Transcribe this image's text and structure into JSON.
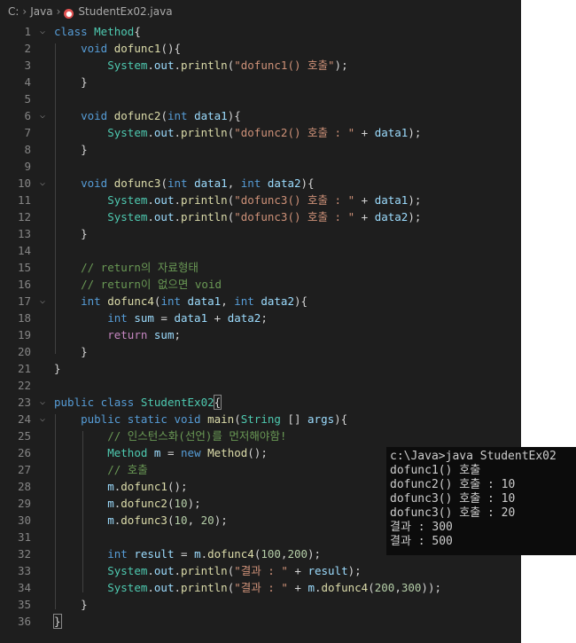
{
  "breadcrumb": {
    "root": "C:",
    "folder": "Java",
    "file": "StudentEx02.java"
  },
  "lines": [
    {
      "n": "1",
      "fold": "⌵",
      "t": [
        [
          "kw",
          "class "
        ],
        [
          "ty",
          "Method"
        ],
        [
          "p",
          "{"
        ]
      ]
    },
    {
      "n": "2",
      "t": [
        [
          "p",
          "    "
        ],
        [
          "kw",
          "void "
        ],
        [
          "fn",
          "dofunc1"
        ],
        [
          "p",
          "(){"
        ]
      ]
    },
    {
      "n": "3",
      "t": [
        [
          "p",
          "        "
        ],
        [
          "ty",
          "System"
        ],
        [
          "p",
          "."
        ],
        [
          "var",
          "out"
        ],
        [
          "p",
          "."
        ],
        [
          "fn",
          "println"
        ],
        [
          "p",
          "("
        ],
        [
          "str",
          "\"dofunc1() 호출\""
        ],
        [
          "p",
          ");"
        ]
      ]
    },
    {
      "n": "4",
      "t": [
        [
          "p",
          "    }"
        ]
      ]
    },
    {
      "n": "5",
      "t": []
    },
    {
      "n": "6",
      "fold": "⌵",
      "t": [
        [
          "p",
          "    "
        ],
        [
          "kw",
          "void "
        ],
        [
          "fn",
          "dofunc2"
        ],
        [
          "p",
          "("
        ],
        [
          "kw",
          "int "
        ],
        [
          "var",
          "data1"
        ],
        [
          "p",
          "){"
        ]
      ]
    },
    {
      "n": "7",
      "t": [
        [
          "p",
          "        "
        ],
        [
          "ty",
          "System"
        ],
        [
          "p",
          "."
        ],
        [
          "var",
          "out"
        ],
        [
          "p",
          "."
        ],
        [
          "fn",
          "println"
        ],
        [
          "p",
          "("
        ],
        [
          "str",
          "\"dofunc2() 호출 : \""
        ],
        [
          "p",
          " + "
        ],
        [
          "var",
          "data1"
        ],
        [
          "p",
          ");"
        ]
      ]
    },
    {
      "n": "8",
      "t": [
        [
          "p",
          "    }"
        ]
      ]
    },
    {
      "n": "9",
      "t": []
    },
    {
      "n": "10",
      "fold": "⌵",
      "t": [
        [
          "p",
          "    "
        ],
        [
          "kw",
          "void "
        ],
        [
          "fn",
          "dofunc3"
        ],
        [
          "p",
          "("
        ],
        [
          "kw",
          "int "
        ],
        [
          "var",
          "data1"
        ],
        [
          "p",
          ", "
        ],
        [
          "kw",
          "int "
        ],
        [
          "var",
          "data2"
        ],
        [
          "p",
          "){"
        ]
      ]
    },
    {
      "n": "11",
      "t": [
        [
          "p",
          "        "
        ],
        [
          "ty",
          "System"
        ],
        [
          "p",
          "."
        ],
        [
          "var",
          "out"
        ],
        [
          "p",
          "."
        ],
        [
          "fn",
          "println"
        ],
        [
          "p",
          "("
        ],
        [
          "str",
          "\"dofunc3() 호출 : \""
        ],
        [
          "p",
          " + "
        ],
        [
          "var",
          "data1"
        ],
        [
          "p",
          ");"
        ]
      ]
    },
    {
      "n": "12",
      "t": [
        [
          "p",
          "        "
        ],
        [
          "ty",
          "System"
        ],
        [
          "p",
          "."
        ],
        [
          "var",
          "out"
        ],
        [
          "p",
          "."
        ],
        [
          "fn",
          "println"
        ],
        [
          "p",
          "("
        ],
        [
          "str",
          "\"dofunc3() 호출 : \""
        ],
        [
          "p",
          " + "
        ],
        [
          "var",
          "data2"
        ],
        [
          "p",
          ");"
        ]
      ]
    },
    {
      "n": "13",
      "t": [
        [
          "p",
          "    }"
        ]
      ]
    },
    {
      "n": "14",
      "t": []
    },
    {
      "n": "15",
      "t": [
        [
          "p",
          "    "
        ],
        [
          "cm",
          "// return의 자료형태"
        ]
      ]
    },
    {
      "n": "16",
      "t": [
        [
          "p",
          "    "
        ],
        [
          "cm",
          "// return이 없으면 void"
        ]
      ]
    },
    {
      "n": "17",
      "fold": "⌵",
      "t": [
        [
          "p",
          "    "
        ],
        [
          "kw",
          "int "
        ],
        [
          "fn",
          "dofunc4"
        ],
        [
          "p",
          "("
        ],
        [
          "kw",
          "int "
        ],
        [
          "var",
          "data1"
        ],
        [
          "p",
          ", "
        ],
        [
          "kw",
          "int "
        ],
        [
          "var",
          "data2"
        ],
        [
          "p",
          "){"
        ]
      ]
    },
    {
      "n": "18",
      "t": [
        [
          "p",
          "        "
        ],
        [
          "kw",
          "int "
        ],
        [
          "var",
          "sum"
        ],
        [
          "p",
          " = "
        ],
        [
          "var",
          "data1"
        ],
        [
          "p",
          " + "
        ],
        [
          "var",
          "data2"
        ],
        [
          "p",
          ";"
        ]
      ]
    },
    {
      "n": "19",
      "t": [
        [
          "p",
          "        "
        ],
        [
          "ctl",
          "return "
        ],
        [
          "var",
          "sum"
        ],
        [
          "p",
          ";"
        ]
      ]
    },
    {
      "n": "20",
      "t": [
        [
          "p",
          "    }"
        ]
      ]
    },
    {
      "n": "21",
      "t": [
        [
          "p",
          "}"
        ]
      ]
    },
    {
      "n": "22",
      "t": []
    },
    {
      "n": "23",
      "fold": "⌵",
      "t": [
        [
          "kw",
          "public class "
        ],
        [
          "ty",
          "StudentEx02"
        ],
        [
          "b",
          "{"
        ]
      ]
    },
    {
      "n": "24",
      "fold": "⌵",
      "t": [
        [
          "p",
          "    "
        ],
        [
          "kw",
          "public static void "
        ],
        [
          "fn",
          "main"
        ],
        [
          "p",
          "("
        ],
        [
          "ty",
          "String"
        ],
        [
          "p",
          " [] "
        ],
        [
          "var",
          "args"
        ],
        [
          "p",
          "){"
        ]
      ]
    },
    {
      "n": "25",
      "t": [
        [
          "p",
          "        "
        ],
        [
          "cm",
          "// 인스턴스화(선언)를 먼저해야함!"
        ]
      ]
    },
    {
      "n": "26",
      "t": [
        [
          "p",
          "        "
        ],
        [
          "ty",
          "Method "
        ],
        [
          "var",
          "m"
        ],
        [
          "p",
          " = "
        ],
        [
          "kw",
          "new "
        ],
        [
          "fn",
          "Method"
        ],
        [
          "p",
          "();"
        ]
      ]
    },
    {
      "n": "27",
      "t": [
        [
          "p",
          "        "
        ],
        [
          "cm",
          "// 호출"
        ]
      ]
    },
    {
      "n": "28",
      "t": [
        [
          "p",
          "        "
        ],
        [
          "var",
          "m"
        ],
        [
          "p",
          "."
        ],
        [
          "fn",
          "dofunc1"
        ],
        [
          "p",
          "();"
        ]
      ]
    },
    {
      "n": "29",
      "t": [
        [
          "p",
          "        "
        ],
        [
          "var",
          "m"
        ],
        [
          "p",
          "."
        ],
        [
          "fn",
          "dofunc2"
        ],
        [
          "p",
          "("
        ],
        [
          "num",
          "10"
        ],
        [
          "p",
          ");"
        ]
      ]
    },
    {
      "n": "30",
      "t": [
        [
          "p",
          "        "
        ],
        [
          "var",
          "m"
        ],
        [
          "p",
          "."
        ],
        [
          "fn",
          "dofunc3"
        ],
        [
          "p",
          "("
        ],
        [
          "num",
          "10"
        ],
        [
          "p",
          ", "
        ],
        [
          "num",
          "20"
        ],
        [
          "p",
          ");"
        ]
      ]
    },
    {
      "n": "31",
      "t": []
    },
    {
      "n": "32",
      "t": [
        [
          "p",
          "        "
        ],
        [
          "kw",
          "int "
        ],
        [
          "var",
          "result"
        ],
        [
          "p",
          " = "
        ],
        [
          "var",
          "m"
        ],
        [
          "p",
          "."
        ],
        [
          "fn",
          "dofunc4"
        ],
        [
          "p",
          "("
        ],
        [
          "num",
          "100"
        ],
        [
          "p",
          ","
        ],
        [
          "num",
          "200"
        ],
        [
          "p",
          ");"
        ]
      ]
    },
    {
      "n": "33",
      "t": [
        [
          "p",
          "        "
        ],
        [
          "ty",
          "System"
        ],
        [
          "p",
          "."
        ],
        [
          "var",
          "out"
        ],
        [
          "p",
          "."
        ],
        [
          "fn",
          "println"
        ],
        [
          "p",
          "("
        ],
        [
          "str",
          "\"결과 : \""
        ],
        [
          "p",
          " + "
        ],
        [
          "var",
          "result"
        ],
        [
          "p",
          ");"
        ]
      ]
    },
    {
      "n": "34",
      "t": [
        [
          "p",
          "        "
        ],
        [
          "ty",
          "System"
        ],
        [
          "p",
          "."
        ],
        [
          "var",
          "out"
        ],
        [
          "p",
          "."
        ],
        [
          "fn",
          "println"
        ],
        [
          "p",
          "("
        ],
        [
          "str",
          "\"결과 : \""
        ],
        [
          "p",
          " + "
        ],
        [
          "var",
          "m"
        ],
        [
          "p",
          "."
        ],
        [
          "fn",
          "dofunc4"
        ],
        [
          "p",
          "("
        ],
        [
          "num",
          "200"
        ],
        [
          "p",
          ","
        ],
        [
          "num",
          "300"
        ],
        [
          "p",
          "));"
        ]
      ]
    },
    {
      "n": "35",
      "t": [
        [
          "p",
          "    }"
        ]
      ]
    },
    {
      "n": "36",
      "t": [
        [
          "b",
          "}"
        ]
      ]
    }
  ],
  "terminal": {
    "lines": [
      "c:\\Java>java StudentEx02",
      "dofunc1() 호출",
      "dofunc2() 호출 : 10",
      "dofunc3() 호출 : 10",
      "dofunc3() 호출 : 20",
      "결과 : 300",
      "결과 : 500"
    ]
  }
}
